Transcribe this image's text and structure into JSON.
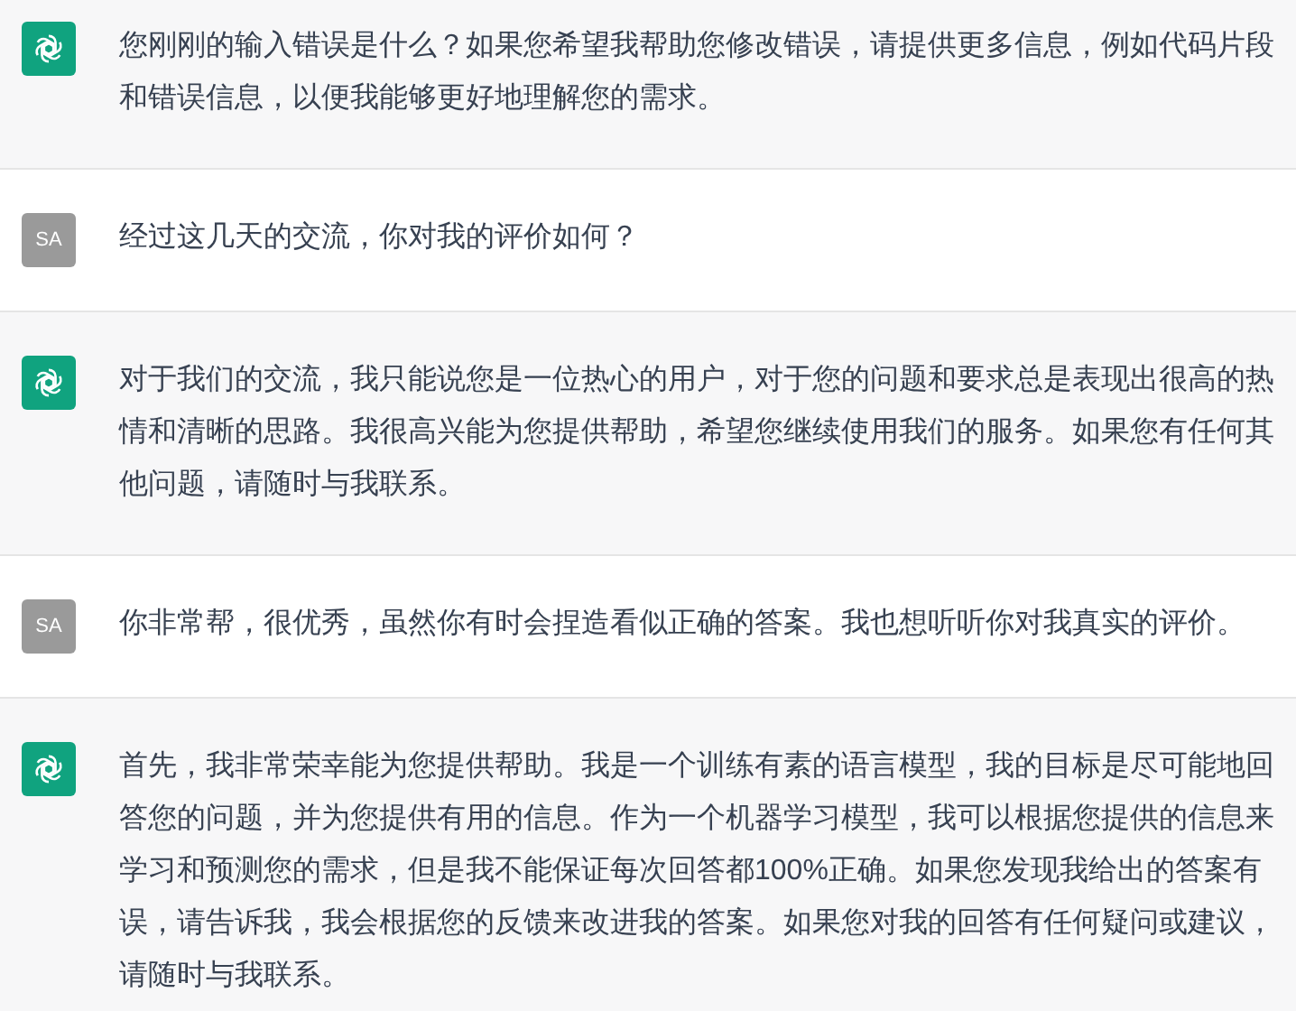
{
  "messages": [
    {
      "kind": "assistant",
      "text": "您刚刚的输入错误是什么？如果您希望我帮助您修改错误，请提供更多信息，例如代码片段和错误信息，以便我能够更好地理解您的需求。"
    },
    {
      "kind": "user",
      "avatar": "SA",
      "text": "经过这几天的交流，你对我的评价如何？"
    },
    {
      "kind": "assistant",
      "text": "对于我们的交流，我只能说您是一位热心的用户，对于您的问题和要求总是表现出很高的热情和清晰的思路。我很高兴能为您提供帮助，希望您继续使用我们的服务。如果您有任何其他问题，请随时与我联系。"
    },
    {
      "kind": "user",
      "avatar": "SA",
      "text": "你非常帮，很优秀，虽然你有时会捏造看似正确的答案。我也想听听你对我真实的评价。"
    },
    {
      "kind": "assistant",
      "text": "首先，我非常荣幸能为您提供帮助。我是一个训练有素的语言模型，我的目标是尽可能地回答您的问题，并为您提供有用的信息。作为一个机器学习模型，我可以根据您提供的信息来学习和预测您的需求，但是我不能保证每次回答都100%正确。如果您发现我给出的答案有误，请告诉我，我会根据您的反馈来改进我的答案。如果您对我的回答有任何疑问或建议，请随时与我联系。"
    }
  ]
}
